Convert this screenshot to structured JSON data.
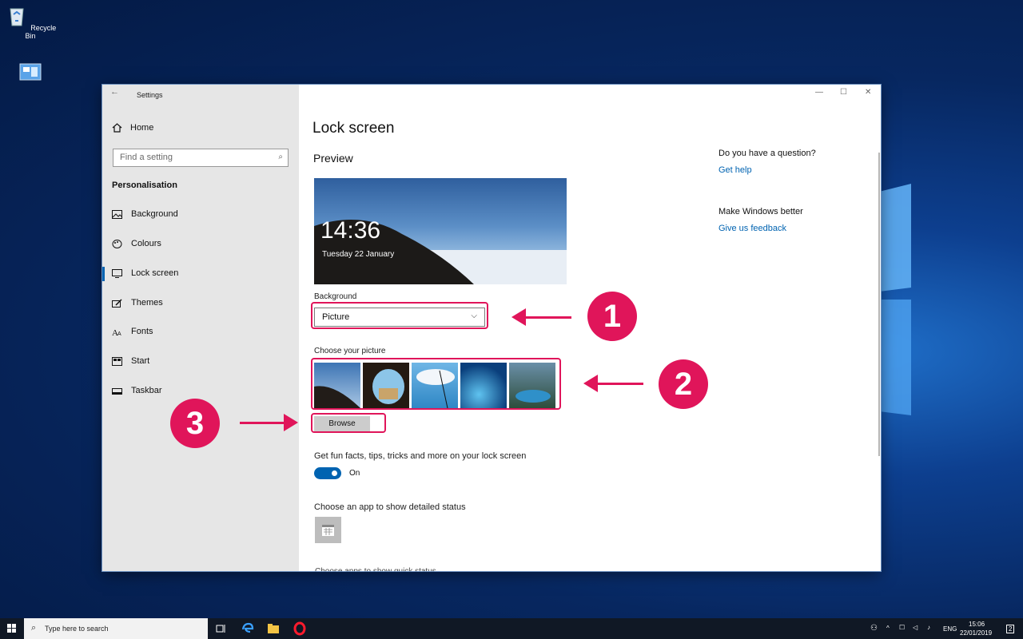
{
  "desktop": {
    "recycle_bin_label": "Recycle Bin"
  },
  "window": {
    "title": "Settings",
    "sidebar": {
      "home": "Home",
      "search_placeholder": "Find a setting",
      "section": "Personalisation",
      "items": [
        {
          "label": "Background",
          "icon": "picture-icon"
        },
        {
          "label": "Colours",
          "icon": "palette-icon"
        },
        {
          "label": "Lock screen",
          "icon": "monitor-icon",
          "selected": true
        },
        {
          "label": "Themes",
          "icon": "brush-icon"
        },
        {
          "label": "Fonts",
          "icon": "font-icon"
        },
        {
          "label": "Start",
          "icon": "start-icon"
        },
        {
          "label": "Taskbar",
          "icon": "taskbar-icon"
        }
      ]
    },
    "main": {
      "title": "Lock screen",
      "preview_heading": "Preview",
      "preview_time": "14:36",
      "preview_date": "Tuesday 22 January",
      "background_label": "Background",
      "background_value": "Picture",
      "choose_picture_label": "Choose your picture",
      "browse_label": "Browse",
      "fun_facts_label": "Get fun facts, tips, tricks and more on your lock screen",
      "toggle_state": "On",
      "detailed_status_label": "Choose an app to show detailed status"
    },
    "help": {
      "question": "Do you have a question?",
      "get_help": "Get help",
      "make_better": "Make Windows better",
      "feedback": "Give us feedback"
    }
  },
  "callouts": {
    "one": "1",
    "two": "2",
    "three": "3",
    "accent": "#e0155a"
  },
  "taskbar": {
    "search_placeholder": "Type here to search",
    "language": "ENG",
    "time": "15:06",
    "date": "22/01/2019",
    "notifications": "2"
  }
}
